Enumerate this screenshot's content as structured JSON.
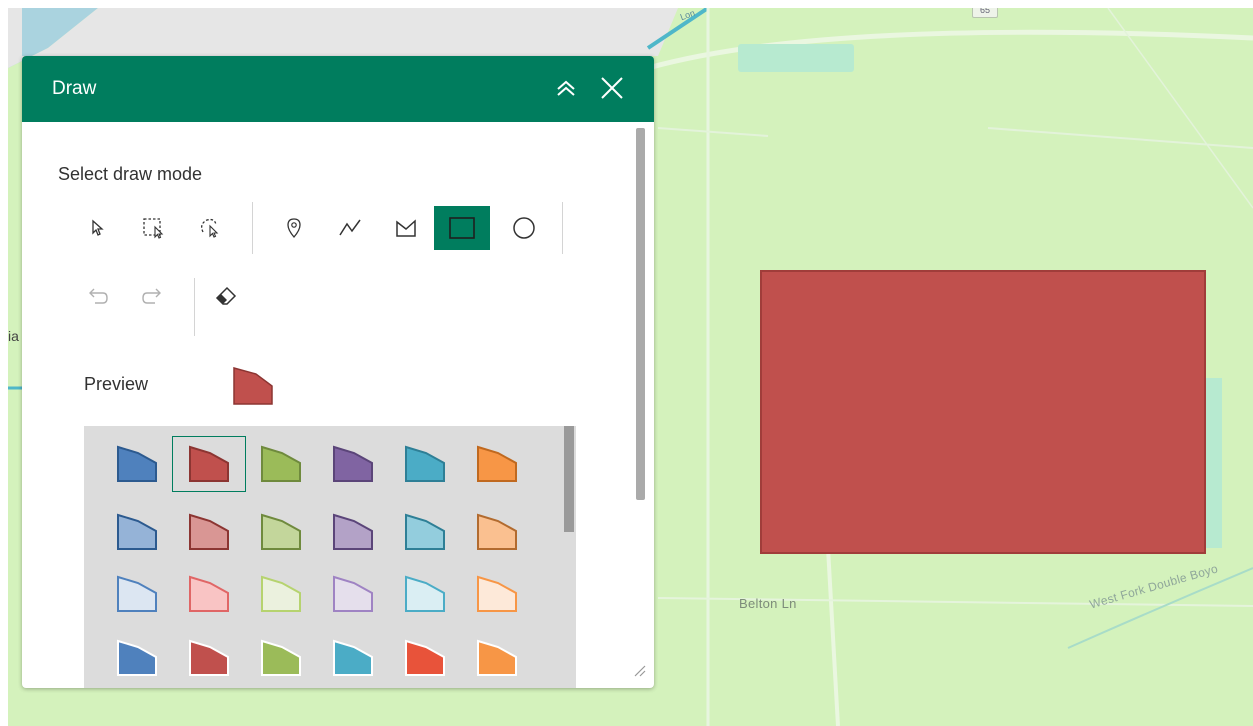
{
  "map": {
    "labels": {
      "belton": "Belton Ln",
      "west_fork": "West Fork Double Boyo",
      "hwy_shield": "65",
      "edge_left": "ia",
      "edge_top": "Lon"
    },
    "drawn_shape_color": "#c0504d"
  },
  "panel": {
    "title": "Draw",
    "accent_color": "#007d5e",
    "collapse_icon": "chevron-double-up-icon",
    "close_icon": "close-icon",
    "mode_label": "Select draw mode",
    "tools": [
      {
        "name": "select",
        "icon": "pointer-icon",
        "active": false
      },
      {
        "name": "rectangle-select",
        "icon": "rectangle-select-icon",
        "active": false
      },
      {
        "name": "lasso-select",
        "icon": "lasso-select-icon",
        "active": false
      },
      {
        "name": "point",
        "icon": "pin-icon",
        "active": false
      },
      {
        "name": "polyline",
        "icon": "polyline-icon",
        "active": false
      },
      {
        "name": "polygon",
        "icon": "polygon-icon",
        "active": false
      },
      {
        "name": "rectangle",
        "icon": "rectangle-icon",
        "active": true
      },
      {
        "name": "circle",
        "icon": "circle-icon",
        "active": false
      },
      {
        "name": "undo",
        "icon": "undo-icon",
        "active": false,
        "disabled": true
      },
      {
        "name": "redo",
        "icon": "redo-icon",
        "active": false,
        "disabled": true
      },
      {
        "name": "clear",
        "icon": "eraser-icon",
        "active": false
      }
    ],
    "preview_label": "Preview",
    "preview_color": "#c0504d",
    "palette": [
      [
        "#4f81bd",
        "#c0504d",
        "#9bbb59",
        "#8064a2",
        "#4bacc6",
        "#f79646"
      ],
      [
        "#95b3d7",
        "#d99694",
        "#c3d69b",
        "#b3a2c7",
        "#93cddd",
        "#fac090"
      ],
      [
        "#dce6f2",
        "#f9c4c4",
        "#ebf1de",
        "#e5dfec",
        "#daeef3",
        "#fde9d9"
      ],
      [
        "#4f81bd",
        "#c0504d",
        "#9bbb59",
        "#4bacc6",
        "#e8533a",
        "#f79646"
      ]
    ],
    "palette_strokes": [
      [
        "#2c5a8f",
        "#8c3532",
        "#6f8a3d",
        "#5b4579",
        "#2e7f96",
        "#c0691f"
      ],
      [
        "#2c5a8f",
        "#8c3532",
        "#6f8a3d",
        "#5b4579",
        "#2e7f96",
        "#b26b2f"
      ],
      [
        "#4f81bd",
        "#e06666",
        "#b6d36f",
        "#9f83c3",
        "#4bacc6",
        "#f79646"
      ],
      [
        "#ffffff",
        "#ffffff",
        "#ffffff",
        "#ffffff",
        "#ffffff",
        "#ffffff"
      ]
    ],
    "selected_swatch": [
      0,
      1
    ]
  }
}
